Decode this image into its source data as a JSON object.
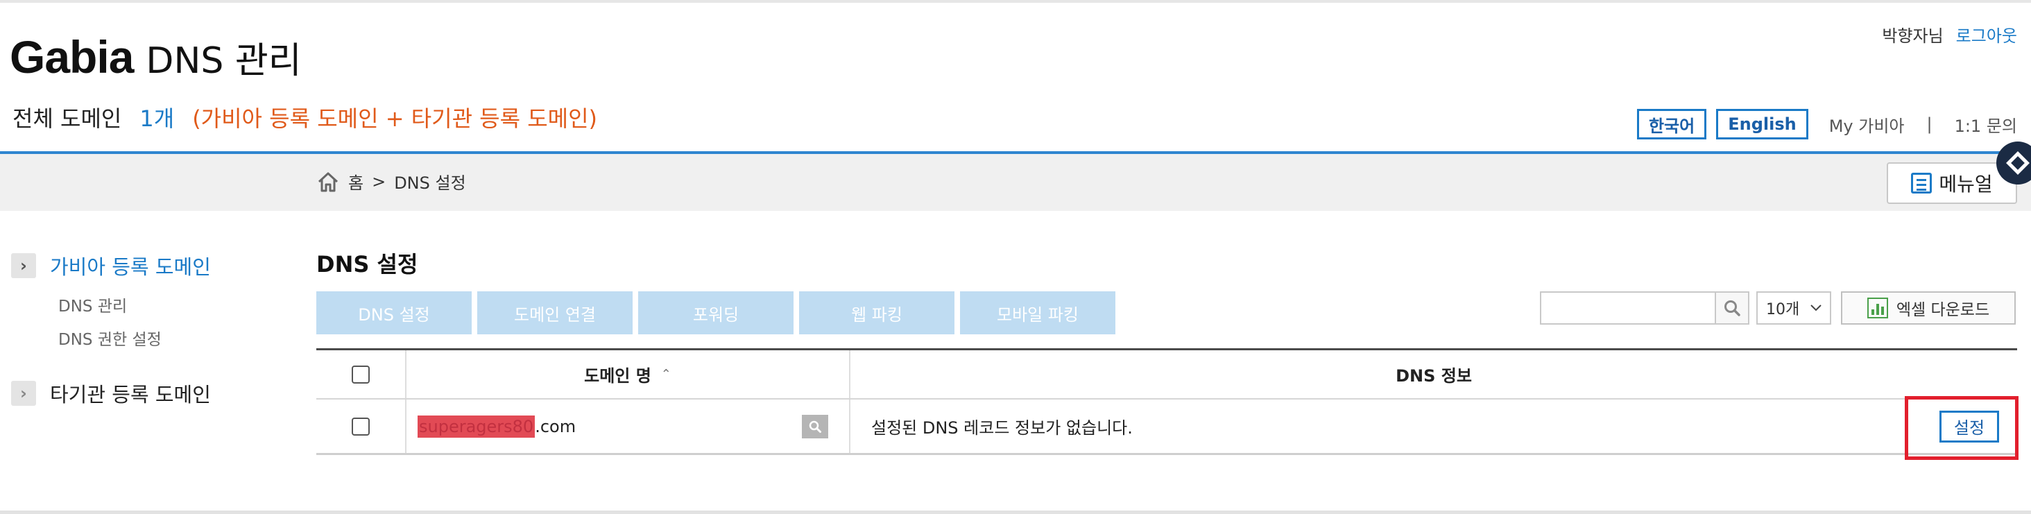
{
  "header": {
    "brand_bold": "Gabia",
    "brand_rest": "DNS 관리",
    "summary_label": "전체 도메인",
    "summary_count": "1개",
    "summary_note": "(가비아 등록 도메인 + 타기관 등록 도메인)",
    "user_name": "박향자님",
    "logout": "로그아웃",
    "lang_korean": "한국어",
    "lang_english": "English",
    "my_gabia": "My 가비아",
    "separator": "|",
    "inquiry": "1:1 문의"
  },
  "breadcrumb": {
    "home": "홈",
    "arrow": ">",
    "current": "DNS 설정"
  },
  "manual_button": "메뉴얼",
  "sidebar": {
    "group1": {
      "title": "가비아 등록 도메인",
      "items": [
        "DNS 관리",
        "DNS 권한 설정"
      ]
    },
    "group2": {
      "title": "타기관 등록 도메인"
    }
  },
  "main": {
    "title": "DNS 설정",
    "tabs": [
      "DNS 설정",
      "도메인 연결",
      "포워딩",
      "웹 파킹",
      "모바일 파킹"
    ],
    "search_placeholder": "",
    "page_size": "10개",
    "excel_button": "엑셀 다운로드"
  },
  "table": {
    "headers": {
      "domain": "도메인 명",
      "sort_indicator": "⌃",
      "dns_info": "DNS 정보"
    },
    "rows": [
      {
        "domain_redacted": "superagers80",
        "domain_tld": ".com",
        "dns_info": "설정된 DNS 레코드 정보가 없습니다.",
        "action": "설정"
      }
    ]
  },
  "colors": {
    "accent_blue": "#1a7ac7",
    "note_orange": "#e05a1a",
    "tab_disabled": "#bfdcf2",
    "highlight_red": "#e21f2d"
  }
}
